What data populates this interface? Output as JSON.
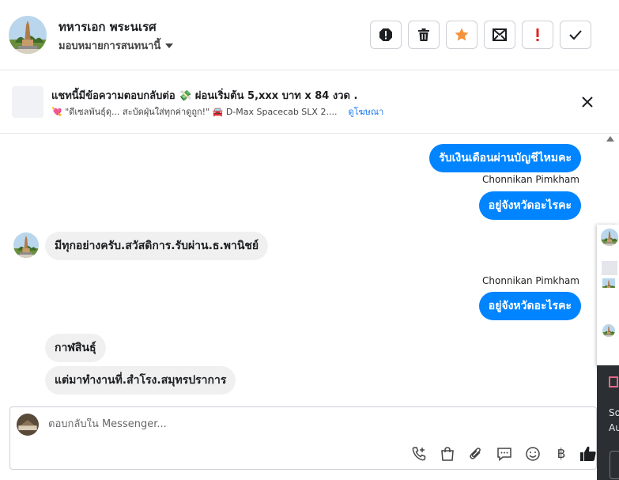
{
  "header": {
    "name": "ทหารเอก พระนเรศ",
    "assign_label": "มอบหมายการสนทนานี้"
  },
  "ad": {
    "title": "แชทนี้มีข้อความตอบกลับต่อ 💸 ผ่อนเริ่มต้น 5,xxx บาท x 84 งวด .",
    "subtitle": "💘 \"ดีเซลพันธุ์ดุ... สะบัดฝุ่นใส่ทุกค่าดูถูก!\" 🚘 D-Max Spacecab SLX 2....",
    "link": "ดูโฆษณา"
  },
  "messages": {
    "m1": "รับเงินเดือนผ่านบัญชีไหมคะ",
    "sender1": "Chonnikan Pimkham",
    "m2": "อยู่จังหวัดอะไรคะ",
    "m3": "มีทุกอย่างครับ.สวัสดิการ.รับผ่าน.ธ.พานิชย์",
    "sender2": "Chonnikan Pimkham",
    "m4": "อยู่จังหวัดอะไรคะ",
    "m5": "กาฬสินธุ์",
    "m6": "แต่มาทำงานที่.สำโรง.สมุทรปราการ"
  },
  "composer": {
    "placeholder": "ตอบกลับใน Messenger...",
    "currency_symbol": "฿"
  },
  "side_panel": {
    "text1": "So",
    "text2": "Au"
  },
  "colors": {
    "outgoing_bubble": "#0084ff",
    "incoming_bubble": "#f0f0f0",
    "star": "#f7923a",
    "alert": "#e02424"
  },
  "icons": {
    "toolbar": [
      "report-icon",
      "trash-icon",
      "star-icon",
      "mail-icon",
      "exclamation-icon",
      "check-icon"
    ],
    "composer": [
      "add-call-icon",
      "shopping-bag-icon",
      "paperclip-icon",
      "chat-bubble-icon",
      "emoji-icon",
      "baht-icon",
      "thumbs-up-icon"
    ]
  }
}
